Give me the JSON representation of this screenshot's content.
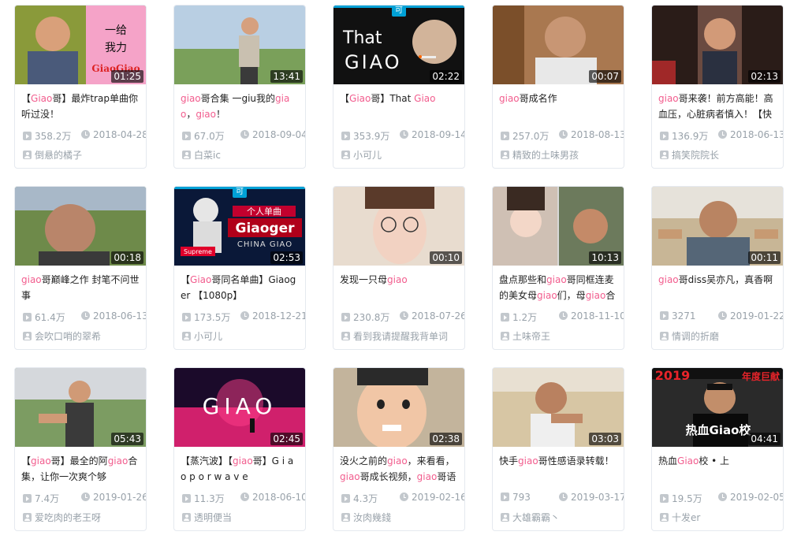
{
  "accent_color": "#f25d8e",
  "videos": [
    {
      "duration": "01:25",
      "title": [
        {
          "t": "【"
        },
        {
          "t": "Giao",
          "h": true
        },
        {
          "t": "哥】最炸trap单曲你听过没！"
        }
      ],
      "views": "358.2万",
      "date": "2018-04-28",
      "uploader": "倒悬的橘子"
    },
    {
      "duration": "13:41",
      "title": [
        {
          "t": "giao",
          "h": true
        },
        {
          "t": "哥合集 一giu我的"
        },
        {
          "t": "giao",
          "h": true
        },
        {
          "t": "，"
        },
        {
          "t": "giao",
          "h": true
        },
        {
          "t": "！"
        }
      ],
      "views": "67.0万",
      "date": "2018-09-04",
      "uploader": "白菜ic"
    },
    {
      "duration": "02:22",
      "ke": "可",
      "thumb_text": "That GIAO",
      "title": [
        {
          "t": "【"
        },
        {
          "t": "Giao",
          "h": true
        },
        {
          "t": "哥】That "
        },
        {
          "t": "Giao",
          "h": true
        }
      ],
      "views": "353.9万",
      "date": "2018-09-14",
      "uploader": "小可儿"
    },
    {
      "duration": "00:07",
      "title": [
        {
          "t": "giao",
          "h": true
        },
        {
          "t": "哥成名作"
        }
      ],
      "views": "257.0万",
      "date": "2018-08-13",
      "uploader": "精致的土味男孩"
    },
    {
      "duration": "02:13",
      "title": [
        {
          "t": "giao",
          "h": true
        },
        {
          "t": "哥来袭！前方高能！高血压，心脏病者慎入！【快"
        }
      ],
      "views": "136.9万",
      "date": "2018-06-13",
      "uploader": "搞笑院院长"
    },
    {
      "duration": "00:18",
      "title": [
        {
          "t": "giao",
          "h": true
        },
        {
          "t": "哥巅峰之作 封笔不问世事"
        }
      ],
      "views": "61.4万",
      "date": "2018-06-13",
      "uploader": "会吹口哨的翠希"
    },
    {
      "duration": "02:53",
      "ke": "可",
      "thumb_text": "Giaoger",
      "thumb_text2": "个人单曲",
      "thumb_text3": "CHINA GIAO",
      "thumb_text4": "Supreme",
      "title": [
        {
          "t": "【"
        },
        {
          "t": "Giao",
          "h": true
        },
        {
          "t": "哥同名单曲】Giaoger 【1080p】"
        }
      ],
      "views": "173.5万",
      "date": "2018-12-21",
      "uploader": "小可儿"
    },
    {
      "duration": "00:10",
      "title": [
        {
          "t": "发现一只母"
        },
        {
          "t": "giao",
          "h": true
        }
      ],
      "views": "230.8万",
      "date": "2018-07-26",
      "uploader": "看到我请提醒我背单词"
    },
    {
      "duration": "10:13",
      "title": [
        {
          "t": "盘点那些和"
        },
        {
          "t": "giao",
          "h": true
        },
        {
          "t": "哥同框连麦的美女母"
        },
        {
          "t": "giao",
          "h": true
        },
        {
          "t": "们，母"
        },
        {
          "t": "giao",
          "h": true
        },
        {
          "t": "合"
        }
      ],
      "views": "1.2万",
      "date": "2018-11-10",
      "uploader": "土味帝王"
    },
    {
      "duration": "00:11",
      "title": [
        {
          "t": "giao",
          "h": true
        },
        {
          "t": "哥diss吴亦凡，真香啊"
        }
      ],
      "views": "3271",
      "date": "2019-01-22",
      "uploader": "情调的折磨"
    },
    {
      "duration": "05:43",
      "title": [
        {
          "t": "【"
        },
        {
          "t": "giao",
          "h": true
        },
        {
          "t": "哥】最全的阿"
        },
        {
          "t": "giao",
          "h": true
        },
        {
          "t": "合集，让你一次爽个够"
        }
      ],
      "views": "7.4万",
      "date": "2019-01-26",
      "uploader": "爱吃肉的老王呀"
    },
    {
      "duration": "02:45",
      "thumb_text": "GIAO",
      "title": [
        {
          "t": "【蒸汽波】【"
        },
        {
          "t": "giao",
          "h": true
        },
        {
          "t": "哥】G i a o p o r w a v e"
        }
      ],
      "views": "11.3万",
      "date": "2018-06-10",
      "uploader": "透明便当"
    },
    {
      "duration": "02:38",
      "title": [
        {
          "t": "没火之前的"
        },
        {
          "t": "giao",
          "h": true
        },
        {
          "t": "，来看看，"
        },
        {
          "t": "giao",
          "h": true
        },
        {
          "t": "哥成长视频，"
        },
        {
          "t": "giao",
          "h": true
        },
        {
          "t": "哥语"
        }
      ],
      "views": "4.3万",
      "date": "2019-02-16",
      "uploader": "汝肉幾錢"
    },
    {
      "duration": "03:03",
      "title": [
        {
          "t": "快手"
        },
        {
          "t": "giao",
          "h": true
        },
        {
          "t": "哥性感语录转载！"
        }
      ],
      "views": "793",
      "date": "2019-03-17",
      "uploader": "大雄霸霸丶"
    },
    {
      "duration": "04:41",
      "thumb_text": "2019",
      "thumb_text2": "年度巨献",
      "thumb_text3": "热血Giao校",
      "title": [
        {
          "t": "热血"
        },
        {
          "t": "Giao",
          "h": true
        },
        {
          "t": "校 • 上"
        }
      ],
      "views": "19.5万",
      "date": "2019-02-05",
      "uploader": "十发er"
    }
  ]
}
